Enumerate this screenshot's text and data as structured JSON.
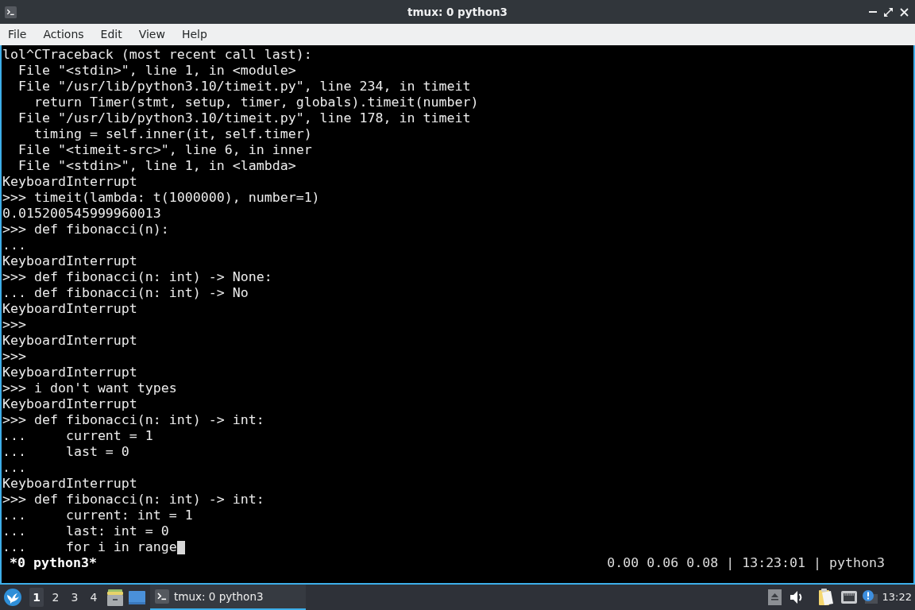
{
  "window": {
    "title": "tmux: 0 python3"
  },
  "menu": [
    "File",
    "Actions",
    "Edit",
    "View",
    "Help"
  ],
  "terminal": {
    "lines": [
      "lol^CTraceback (most recent call last):",
      "  File \"<stdin>\", line 1, in <module>",
      "  File \"/usr/lib/python3.10/timeit.py\", line 234, in timeit",
      "    return Timer(stmt, setup, timer, globals).timeit(number)",
      "  File \"/usr/lib/python3.10/timeit.py\", line 178, in timeit",
      "    timing = self.inner(it, self.timer)",
      "  File \"<timeit-src>\", line 6, in inner",
      "  File \"<stdin>\", line 1, in <lambda>",
      "KeyboardInterrupt",
      ">>> timeit(lambda: t(1000000), number=1)",
      "0.015200545999960013",
      ">>> def fibonacci(n):",
      "...",
      "KeyboardInterrupt",
      ">>> def fibonacci(n: int) -> None:",
      "... def fibonacci(n: int) -> No",
      "KeyboardInterrupt",
      ">>>",
      "KeyboardInterrupt",
      ">>>",
      "KeyboardInterrupt",
      ">>> i don't want types",
      "KeyboardInterrupt",
      ">>> def fibonacci(n: int) -> int:",
      "...     current = 1",
      "...     last = 0",
      "...",
      "KeyboardInterrupt",
      ">>> def fibonacci(n: int) -> int:",
      "...     current: int = 1",
      "...     last: int = 0",
      "...     for i in range"
    ],
    "cursor": true
  },
  "tmux_status": {
    "left": "*0 python3*",
    "right": "0.00 0.06 0.08 | 13:23:01 | python3"
  },
  "taskbar": {
    "workspaces": [
      {
        "label": "1",
        "selected": true
      },
      {
        "label": "2",
        "selected": false
      },
      {
        "label": "3",
        "selected": false
      },
      {
        "label": "4",
        "selected": false
      }
    ],
    "tasks": [
      {
        "label": "tmux: 0 python3",
        "selected": true
      }
    ],
    "clock": "13:22"
  }
}
